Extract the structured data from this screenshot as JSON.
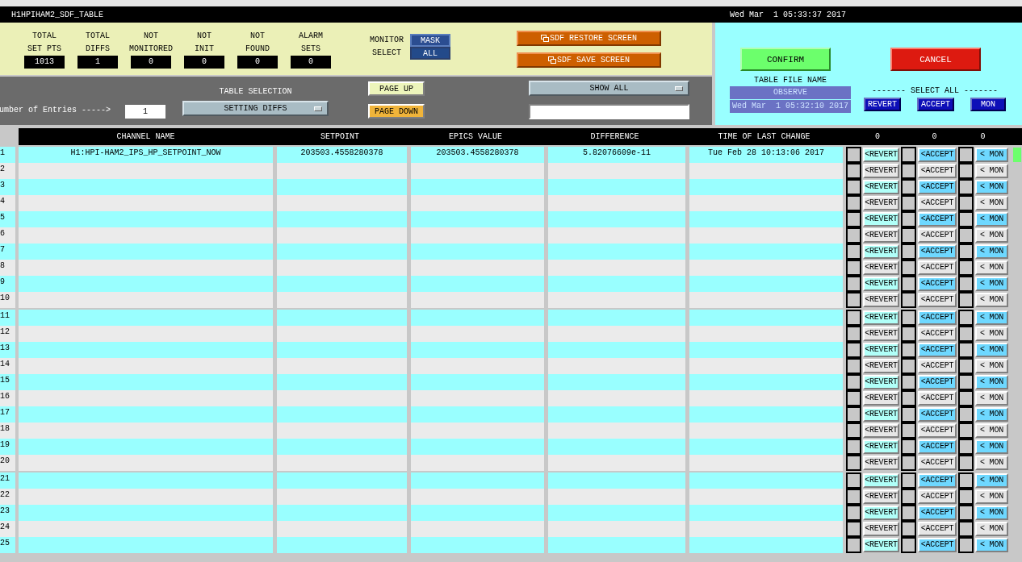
{
  "header": {
    "title": "H1HPIHAM2_SDF_TABLE",
    "datetime": "Wed Mar  1 05:33:37 2017"
  },
  "stats": [
    {
      "label": "TOTAL\nSET PTS",
      "value": "1013"
    },
    {
      "label": "TOTAL\nDIFFS",
      "value": "1"
    },
    {
      "label": "NOT\nMONITORED",
      "value": "0"
    },
    {
      "label": "NOT\nINIT",
      "value": "0"
    },
    {
      "label": "NOT\nFOUND",
      "value": "0"
    },
    {
      "label": "ALARM\nSETS",
      "value": "0"
    }
  ],
  "monitor_select": {
    "label": "MONITOR\nSELECT",
    "options": [
      {
        "label": "MASK",
        "selected": true
      },
      {
        "label": "ALL",
        "selected": false
      }
    ]
  },
  "screen_buttons": [
    "SDF RESTORE SCREEN",
    "SDF SAVE SCREEN"
  ],
  "entries": {
    "label": "umber of Entries ----->",
    "value": "1"
  },
  "table_selection": {
    "label": "TABLE SELECTION",
    "value": "SETTING DIFFS"
  },
  "page_buttons": [
    {
      "label": "PAGE UP",
      "kind": "up"
    },
    {
      "label": "PAGE DOWN",
      "kind": "down"
    }
  ],
  "filter": {
    "value": "SHOW ALL"
  },
  "confirm": "CONFIRM",
  "cancel": "CANCEL",
  "table_file": {
    "label": "TABLE FILE NAME",
    "name": "OBSERVE",
    "date": "Wed Mar  1 05:32:10 2017"
  },
  "select_all": {
    "label": "------- SELECT ALL -------",
    "buttons": [
      "REVERT",
      "ACCEPT",
      "MON"
    ]
  },
  "columns": [
    "CHANNEL NAME",
    "SETPOINT",
    "EPICS VALUE",
    "DIFFERENCE",
    "TIME OF LAST CHANGE",
    "0",
    "0",
    "0"
  ],
  "rows": [
    {
      "num": "1",
      "channel": "H1:HPI-HAM2_IPS_HP_SETPOINT_NOW",
      "setpoint": "203503.4558280378",
      "epics": "203503.4558280378",
      "difference": "5.82076609e-11",
      "time": "Tue Feb 28 10:13:06 2017",
      "flag": true,
      "actions": [
        {
          "label": "<REVERT",
          "checked": false
        },
        {
          "label": "<ACCEPT",
          "checked": false
        },
        {
          "label": "< MON",
          "checked": false
        }
      ]
    },
    {
      "num": "2",
      "flag": false,
      "actions": [
        {
          "label": "<REVERT",
          "checked": false
        },
        {
          "label": "<ACCEPT",
          "checked": false
        },
        {
          "label": "< MON",
          "checked": false
        }
      ]
    },
    {
      "num": "3",
      "flag": false,
      "actions": [
        {
          "label": "<REVERT",
          "checked": false
        },
        {
          "label": "<ACCEPT",
          "checked": false
        },
        {
          "label": "< MON",
          "checked": false
        }
      ]
    },
    {
      "num": "4",
      "flag": false,
      "actions": [
        {
          "label": "<REVERT",
          "checked": false
        },
        {
          "label": "<ACCEPT",
          "checked": false
        },
        {
          "label": "< MON",
          "checked": false
        }
      ]
    },
    {
      "num": "5",
      "flag": false,
      "actions": [
        {
          "label": "<REVERT",
          "checked": false
        },
        {
          "label": "<ACCEPT",
          "checked": false
        },
        {
          "label": "< MON",
          "checked": false
        }
      ]
    },
    {
      "num": "6",
      "flag": false,
      "actions": [
        {
          "label": "<REVERT",
          "checked": false
        },
        {
          "label": "<ACCEPT",
          "checked": false
        },
        {
          "label": "< MON",
          "checked": false
        }
      ]
    },
    {
      "num": "7",
      "flag": false,
      "actions": [
        {
          "label": "<REVERT",
          "checked": false
        },
        {
          "label": "<ACCEPT",
          "checked": false
        },
        {
          "label": "< MON",
          "checked": false
        }
      ]
    },
    {
      "num": "8",
      "flag": false,
      "actions": [
        {
          "label": "<REVERT",
          "checked": false
        },
        {
          "label": "<ACCEPT",
          "checked": false
        },
        {
          "label": "< MON",
          "checked": false
        }
      ]
    },
    {
      "num": "9",
      "flag": false,
      "actions": [
        {
          "label": "<REVERT",
          "checked": false
        },
        {
          "label": "<ACCEPT",
          "checked": false
        },
        {
          "label": "< MON",
          "checked": false
        }
      ]
    },
    {
      "num": "10",
      "flag": false,
      "actions": [
        {
          "label": "<REVERT",
          "checked": false
        },
        {
          "label": "<ACCEPT",
          "checked": false
        },
        {
          "label": "< MON",
          "checked": false
        }
      ]
    },
    {
      "num": "11",
      "flag": false,
      "actions": [
        {
          "label": "<REVERT",
          "checked": false
        },
        {
          "label": "<ACCEPT",
          "checked": false
        },
        {
          "label": "< MON",
          "checked": false
        }
      ]
    },
    {
      "num": "12",
      "flag": false,
      "actions": [
        {
          "label": "<REVERT",
          "checked": false
        },
        {
          "label": "<ACCEPT",
          "checked": false
        },
        {
          "label": "< MON",
          "checked": false
        }
      ]
    },
    {
      "num": "13",
      "flag": false,
      "actions": [
        {
          "label": "<REVERT",
          "checked": false
        },
        {
          "label": "<ACCEPT",
          "checked": false
        },
        {
          "label": "< MON",
          "checked": false
        }
      ]
    },
    {
      "num": "14",
      "flag": false,
      "actions": [
        {
          "label": "<REVERT",
          "checked": false
        },
        {
          "label": "<ACCEPT",
          "checked": false
        },
        {
          "label": "< MON",
          "checked": false
        }
      ]
    },
    {
      "num": "15",
      "flag": false,
      "actions": [
        {
          "label": "<REVERT",
          "checked": false
        },
        {
          "label": "<ACCEPT",
          "checked": false
        },
        {
          "label": "< MON",
          "checked": false
        }
      ]
    },
    {
      "num": "16",
      "flag": false,
      "actions": [
        {
          "label": "<REVERT",
          "checked": false
        },
        {
          "label": "<ACCEPT",
          "checked": false
        },
        {
          "label": "< MON",
          "checked": false
        }
      ]
    },
    {
      "num": "17",
      "flag": false,
      "actions": [
        {
          "label": "<REVERT",
          "checked": false
        },
        {
          "label": "<ACCEPT",
          "checked": false
        },
        {
          "label": "< MON",
          "checked": false
        }
      ]
    },
    {
      "num": "18",
      "flag": false,
      "actions": [
        {
          "label": "<REVERT",
          "checked": false
        },
        {
          "label": "<ACCEPT",
          "checked": false
        },
        {
          "label": "< MON",
          "checked": false
        }
      ]
    },
    {
      "num": "19",
      "flag": false,
      "actions": [
        {
          "label": "<REVERT",
          "checked": false
        },
        {
          "label": "<ACCEPT",
          "checked": false
        },
        {
          "label": "< MON",
          "checked": false
        }
      ]
    },
    {
      "num": "20",
      "flag": false,
      "actions": [
        {
          "label": "<REVERT",
          "checked": false
        },
        {
          "label": "<ACCEPT",
          "checked": false
        },
        {
          "label": "< MON",
          "checked": false
        }
      ]
    },
    {
      "num": "21",
      "flag": false,
      "actions": [
        {
          "label": "<REVERT",
          "checked": false
        },
        {
          "label": "<ACCEPT",
          "checked": false
        },
        {
          "label": "< MON",
          "checked": false
        }
      ]
    },
    {
      "num": "22",
      "flag": false,
      "actions": [
        {
          "label": "<REVERT",
          "checked": false
        },
        {
          "label": "<ACCEPT",
          "checked": false
        },
        {
          "label": "< MON",
          "checked": false
        }
      ]
    },
    {
      "num": "23",
      "flag": false,
      "actions": [
        {
          "label": "<REVERT",
          "checked": false
        },
        {
          "label": "<ACCEPT",
          "checked": false
        },
        {
          "label": "< MON",
          "checked": false
        }
      ]
    },
    {
      "num": "24",
      "flag": false,
      "actions": [
        {
          "label": "<REVERT",
          "checked": false
        },
        {
          "label": "<ACCEPT",
          "checked": false
        },
        {
          "label": "< MON",
          "checked": false
        }
      ]
    },
    {
      "num": "25",
      "flag": false,
      "actions": [
        {
          "label": "<REVERT",
          "checked": false
        },
        {
          "label": "<ACCEPT",
          "checked": false
        },
        {
          "label": "< MON",
          "checked": false
        }
      ]
    }
  ]
}
